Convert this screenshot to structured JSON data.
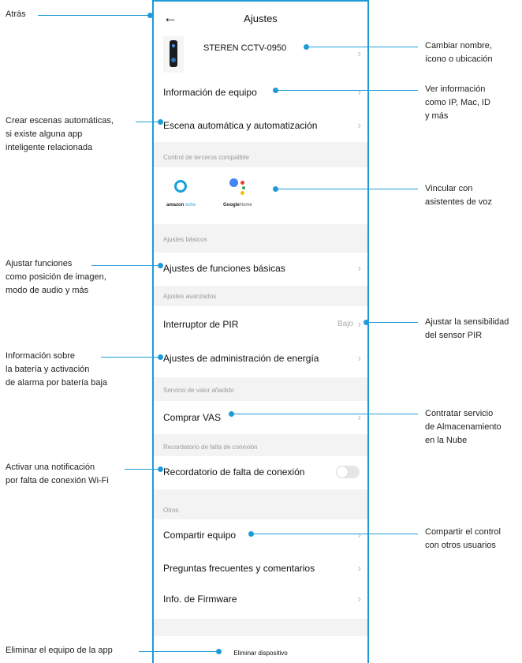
{
  "header": {
    "back_icon": "←",
    "title": "Ajustes"
  },
  "device": {
    "name": "STEREN CCTV-0950"
  },
  "rows": {
    "info_equipo": "Información de equipo",
    "escena": "Escena automática y automatización",
    "funciones_basicas": "Ajustes de funciones básicas",
    "pir": "Interruptor de PIR",
    "pir_value": "Bajo",
    "energia": "Ajustes de administración de energía",
    "vas": "Comprar VAS",
    "recordatorio": "Recordatorio de falta de conexión",
    "compartir": "Compartir equipo",
    "faq": "Preguntas frecuentes y comentarios",
    "firmware": "Info. de Firmware",
    "eliminar": "Eliminar dispositivo"
  },
  "sections": {
    "terceros": "Control de terceros compatible",
    "basicos": "Ajustes básicos",
    "avanzados": "Ajustes avanzados",
    "valor": "Servicio de valor añadido",
    "recordatorio": "Recordatorio de falta de conexión",
    "otros": "Otros"
  },
  "third_party": {
    "amazon_a": "amazon",
    "amazon_b": "echo",
    "google_a": "Google",
    "google_b": "Home"
  },
  "chevron": "›",
  "annotations": {
    "left": {
      "atras": "Atrás",
      "escenas": [
        "Crear escenas automáticas,",
        "si existe alguna app",
        "inteligente relacionada"
      ],
      "ajustar": [
        "Ajustar funciones",
        "como posición de imagen,",
        "modo de audio y más"
      ],
      "bateria": [
        "Información sobre",
        "la batería y activación",
        "de alarma por batería baja"
      ],
      "notificacion": [
        "Activar una notificación",
        "por falta de conexión Wi-Fi"
      ],
      "eliminar": "Eliminar el equipo de la app"
    },
    "right": {
      "cambiar": [
        "Cambiar nombre,",
        "ícono o ubicación"
      ],
      "ver_info": [
        "Ver información",
        "como IP, Mac, ID",
        "y más"
      ],
      "vincular": [
        "Vincular con",
        "asistentes de voz"
      ],
      "sensibilidad": [
        "Ajustar la sensibilidad",
        "del sensor PIR"
      ],
      "contratar": [
        "Contratar servicio",
        "de Almacenamiento",
        "en la Nube"
      ],
      "compartir": [
        "Compartir el control",
        "con otros usuarios"
      ]
    }
  },
  "colors": {
    "accent": "#1E9BD7",
    "section_bg": "#f3f3f3"
  }
}
